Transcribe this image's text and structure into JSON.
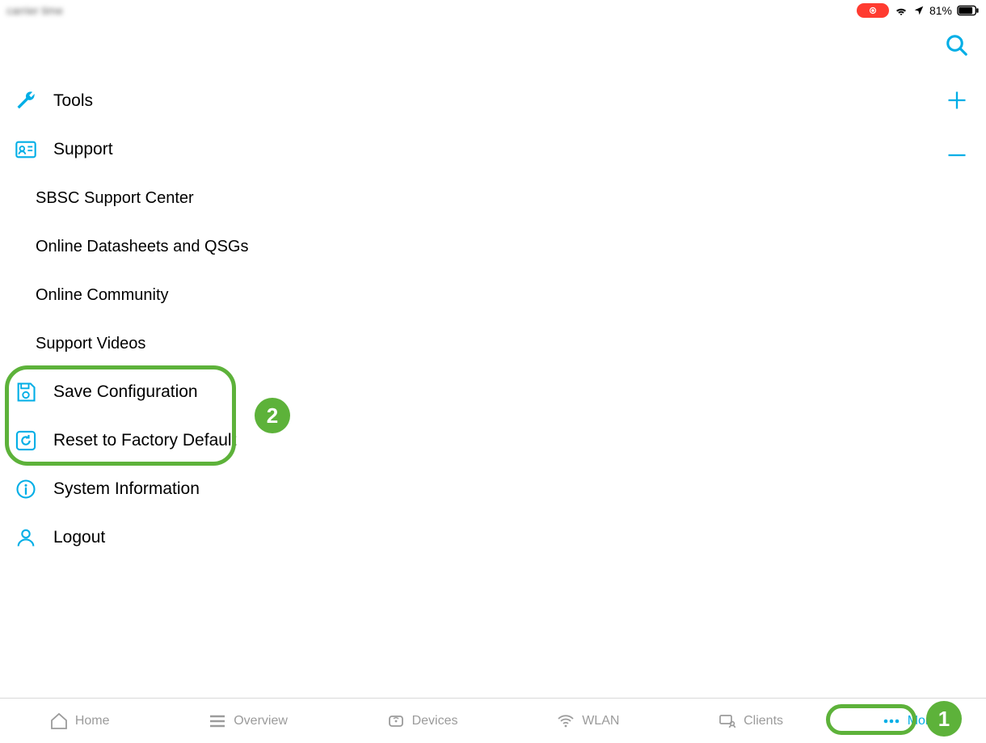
{
  "status_bar": {
    "left_text": "carrier time",
    "battery_percent": "81%"
  },
  "top_actions": {
    "search": "Search",
    "add": "Add",
    "collapse": "Collapse"
  },
  "menu": {
    "tools": "Tools",
    "support": "Support",
    "support_items": [
      "SBSC Support Center",
      "Online Datasheets and QSGs",
      "Online Community",
      "Support Videos"
    ],
    "save_config": "Save Configuration",
    "reset_factory": "Reset to Factory Default",
    "system_info": "System Information",
    "logout": "Logout"
  },
  "annotations": {
    "badge1": "1",
    "badge2": "2"
  },
  "tabs": {
    "home": "Home",
    "overview": "Overview",
    "devices": "Devices",
    "wlan": "WLAN",
    "clients": "Clients",
    "more": "More"
  },
  "colors": {
    "accent": "#00aee6",
    "annotation": "#5db23a",
    "recording": "#ff3b30"
  }
}
